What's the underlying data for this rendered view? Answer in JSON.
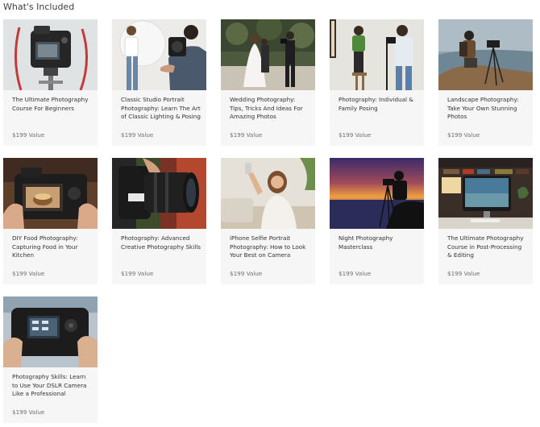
{
  "section": {
    "title": "What's Included"
  },
  "courses": [
    {
      "title": "The Ultimate Photography Course For Beginners",
      "value": "$199 Value"
    },
    {
      "title": "Classic Studio Portrait Photography: Learn The Art of Classic Lighting & Posing",
      "value": "$199 Value"
    },
    {
      "title": "Wedding Photography: Tips, Tricks And Ideas For Amazing Photos",
      "value": "$199 Value"
    },
    {
      "title": "Photography: Individual & Family Posing",
      "value": "$199 Value"
    },
    {
      "title": "Landscape Photography: Take Your Own Stunning Photos",
      "value": "$199 Value"
    },
    {
      "title": "DIY Food Photography: Capturing Food in Your Kitchen",
      "value": "$199 Value"
    },
    {
      "title": "Photography: Advanced Creative Photography Skills",
      "value": "$199 Value"
    },
    {
      "title": "iPhone Selfie Portrait Photography: How to Look Your Best on Camera",
      "value": "$199 Value"
    },
    {
      "title": "Night Photography Masterclass",
      "value": "$199 Value"
    },
    {
      "title": "The Ultimate Photography Course in Post-Processing & Editing",
      "value": "$199 Value"
    },
    {
      "title": "Photography Skills: Learn to Use Your DSLR Camera Like a Professional",
      "value": "$199 Value"
    }
  ]
}
